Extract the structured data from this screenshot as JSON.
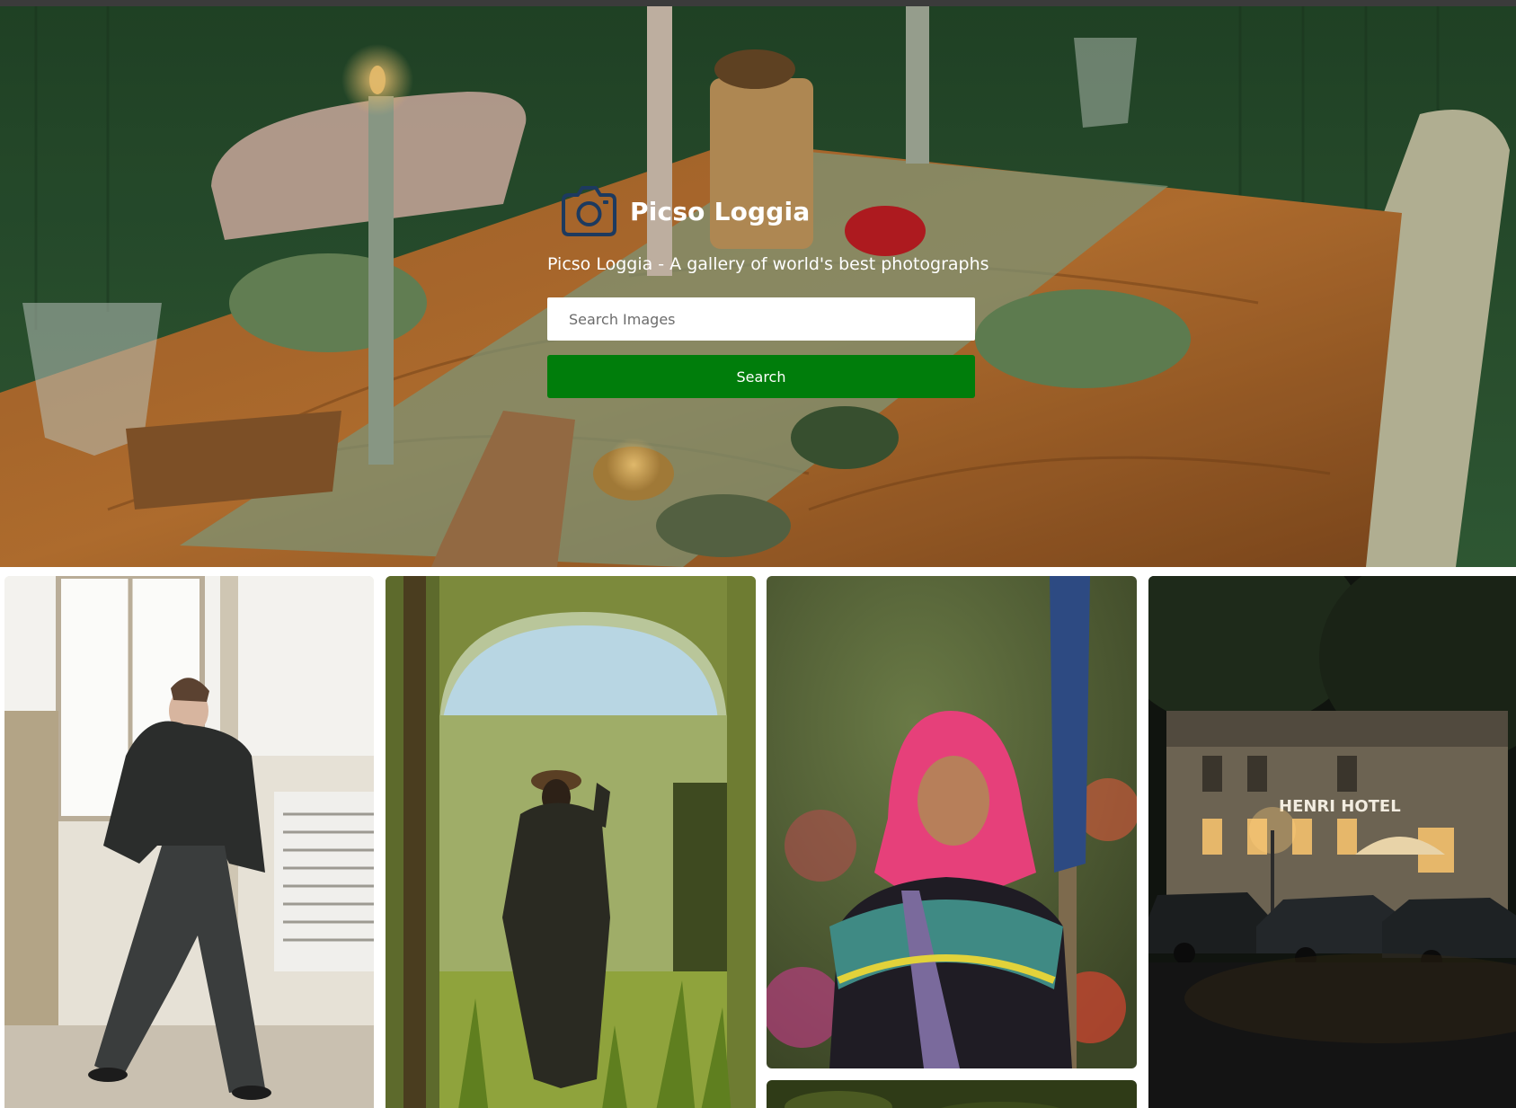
{
  "header": {
    "brand_title": "Picso Loggia",
    "tagline": "Picso Loggia - A gallery of world's best photographs",
    "logo_icon": "camera-icon"
  },
  "search": {
    "placeholder": "Search Images",
    "value": "",
    "button_label": "Search"
  },
  "colors": {
    "search_button": "#007d0b",
    "logo": "#1d3a5f",
    "hero_wall": "#2f5a34"
  },
  "gallery": {
    "images": [
      {
        "subject": "person in dark oversized clothing posing in a bright room"
      },
      {
        "subject": "person in long coat and hat under a moss-covered stone arch"
      },
      {
        "subject": "woman wearing a pink headscarf and embroidered shawl"
      },
      {
        "subject": "green foliage"
      },
      {
        "subject": "hotel facade at night with parked cars",
        "sign_text": "HENRI HOTEL"
      }
    ]
  }
}
